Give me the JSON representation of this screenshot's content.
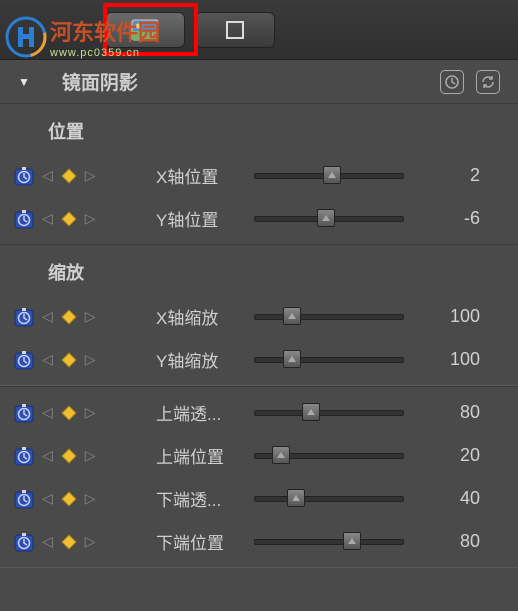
{
  "watermark": {
    "line1": "河东软件园",
    "line2": "www.pc0359.cn"
  },
  "panel": {
    "title": "镜面阴影"
  },
  "sections": {
    "position": {
      "label": "位置"
    },
    "scale": {
      "label": "缩放"
    },
    "gradient": {
      "label": ""
    }
  },
  "params": {
    "xpos": {
      "label": "X轴位置",
      "value": "2",
      "pct": 52
    },
    "ypos": {
      "label": "Y轴位置",
      "value": "-6",
      "pct": 48
    },
    "xscale": {
      "label": "X轴缩放",
      "value": "100",
      "pct": 25
    },
    "yscale": {
      "label": "Y轴缩放",
      "value": "100",
      "pct": 25
    },
    "topOpacity": {
      "label": "上端透...",
      "value": "80",
      "pct": 38
    },
    "topPos": {
      "label": "上端位置",
      "value": "20",
      "pct": 18
    },
    "botOpacity": {
      "label": "下端透...",
      "value": "40",
      "pct": 28
    },
    "botPos": {
      "label": "下端位置",
      "value": "80",
      "pct": 65
    }
  }
}
